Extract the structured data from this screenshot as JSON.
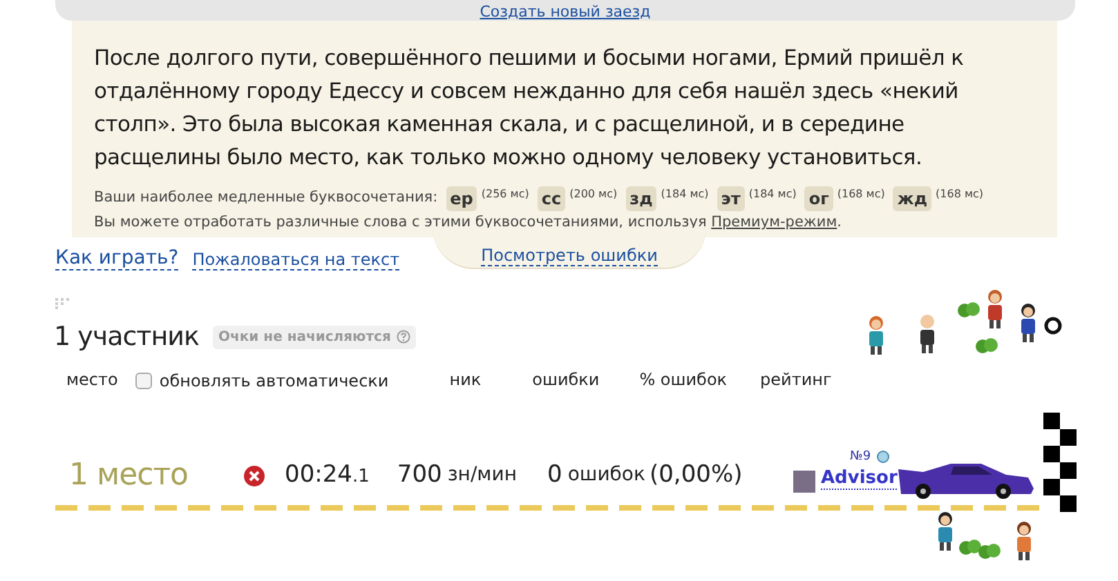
{
  "top_link": "Создать новый заезд",
  "text": {
    "paragraph": "После долгого пути, совершённого пешими и босыми ногами, Ермий пришёл к отдалённому городу Едессу и совсем нежданно для себя нашёл здесь «некий столп». Это была высокая каменная скала, и с расщелиной, и в середине расщелины было место, как только можно одному человеку установиться.",
    "slow_label": "Ваши наиболее медленные буквосочетания:",
    "combos": [
      {
        "letters": "ер",
        "time": "(256 мс)"
      },
      {
        "letters": "сс",
        "time": "(200 мс)"
      },
      {
        "letters": "зд",
        "time": "(184 мс)"
      },
      {
        "letters": "эт",
        "time": "(184 мс)"
      },
      {
        "letters": "ог",
        "time": "(168 мс)"
      },
      {
        "letters": "жд",
        "time": "(168 мс)"
      }
    ],
    "premium_before": "Вы можете отработать различные слова с этими буквосочетаниями, используя",
    "premium_link": "Премиум-режим",
    "premium_after": "."
  },
  "errors_tab": "Посмотреть ошибки",
  "links": [
    "Как играть?",
    "Пожаловаться на текст"
  ],
  "participants": {
    "title": "1 участник",
    "badge": "Очки не начисляются"
  },
  "header": {
    "place": "место",
    "auto_update": {
      "label": "обновлять автоматически",
      "checked": false
    },
    "columns": [
      "ник",
      "ошибки",
      "% ошибок",
      "рейтинг"
    ]
  },
  "racer": {
    "place": "1 место",
    "time": "00:24",
    "time_fraction": ".1",
    "speed": "700",
    "speed_unit": "зн/мин",
    "errors": "0",
    "errors_label": "ошибок",
    "error_rate": "(0,00%)",
    "number": "№9",
    "name": "Advisor"
  }
}
